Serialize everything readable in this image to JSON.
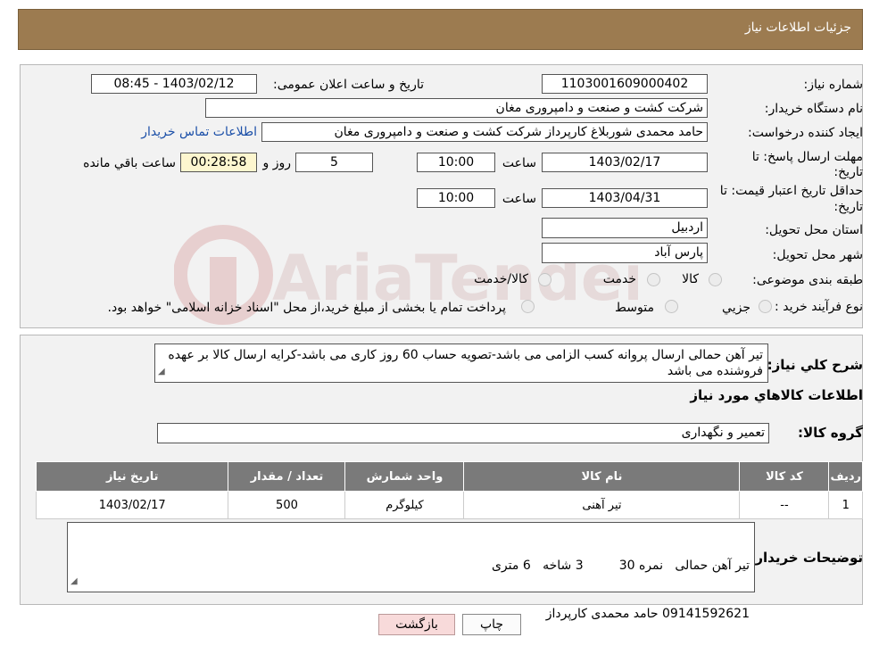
{
  "header": {
    "title": "جزئیات اطلاعات نیاز"
  },
  "form": {
    "need_number_label": "شماره نیاز:",
    "need_number": "1103001609000402",
    "announce_label": "تاریخ و ساعت اعلان عمومی:",
    "announce_value": "1403/02/12 - 08:45",
    "buyer_org_label": "نام دستگاه خریدار:",
    "buyer_org": "شرکت کشت و صنعت و دامپروری مغان",
    "creator_label": "ایجاد کننده درخواست:",
    "creator": "حامد محمدی شوربلاغ کارپرداز شرکت کشت و صنعت و دامپروری مغان",
    "contact_link": "اطلاعات تماس خریدار",
    "deadline_label_1": "مهلت ارسال پاسخ: تا",
    "deadline_label_2": "تاریخ:",
    "deadline_date": "1403/02/17",
    "time_label": "ساعت",
    "deadline_time": "10:00",
    "days_value": "5",
    "days_label": "روز و",
    "remaining_time": "00:28:58",
    "remaining_label": "ساعت باقي مانده",
    "validity_label_1": "حداقل تاریخ اعتبار قیمت: تا",
    "validity_label_2": "تاریخ:",
    "validity_date": "1403/04/31",
    "validity_time": "10:00",
    "province_label": "استان محل تحویل:",
    "province": "اردبیل",
    "city_label": "شهر محل تحویل:",
    "city": "پارس آباد",
    "category_label": "طبقه بندی موضوعی:",
    "category_options": [
      "کالا",
      "خدمت",
      "کالا/خدمت"
    ],
    "process_label": "نوع فرآیند خرید :",
    "process_options": [
      "جزیي",
      "متوسط"
    ],
    "process_note": "پرداخت تمام یا بخشی از مبلغ خرید،از محل \"اسناد خزانه اسلامی\" خواهد بود."
  },
  "description": {
    "label": "شرح کلي نياز:",
    "text": "تیر آهن حمالی ارسال پروانه کسب الزامی می باشد-تصویه حساب 60 روز کاری می باشد-کرایه ارسال کالا بر عهده فروشنده می باشد"
  },
  "goods": {
    "section_title": "اطلاعات کالاهاي مورد نياز",
    "group_label": "گروه کالا:",
    "group_value": "تعمیر و نگهداری",
    "columns": [
      "رديف",
      "کد کالا",
      "نام کالا",
      "واحد شمارش",
      "تعداد / مقدار",
      "تاریخ نیاز"
    ],
    "rows": [
      [
        "1",
        "--",
        "تیر آهنی",
        "کیلوگرم",
        "500",
        "1403/02/17"
      ]
    ]
  },
  "buyer_notes": {
    "label": "توضیحات خریدار:",
    "line1": "تیر آهن حمالی   نمره 30         3 شاخه   6 متری",
    "line2": "09141592621 حامد محمدی کارپرداز"
  },
  "buttons": {
    "print": "چاپ",
    "back": "بازگشت"
  },
  "watermark": {
    "text": "AriaTender.neT"
  },
  "colors": {
    "header_bg": "#9c7b50",
    "panel_bg": "#f2f2f2",
    "table_header": "#7a7a7a",
    "back_button": "#f8dada",
    "timer_bg": "#fdf6cf"
  }
}
